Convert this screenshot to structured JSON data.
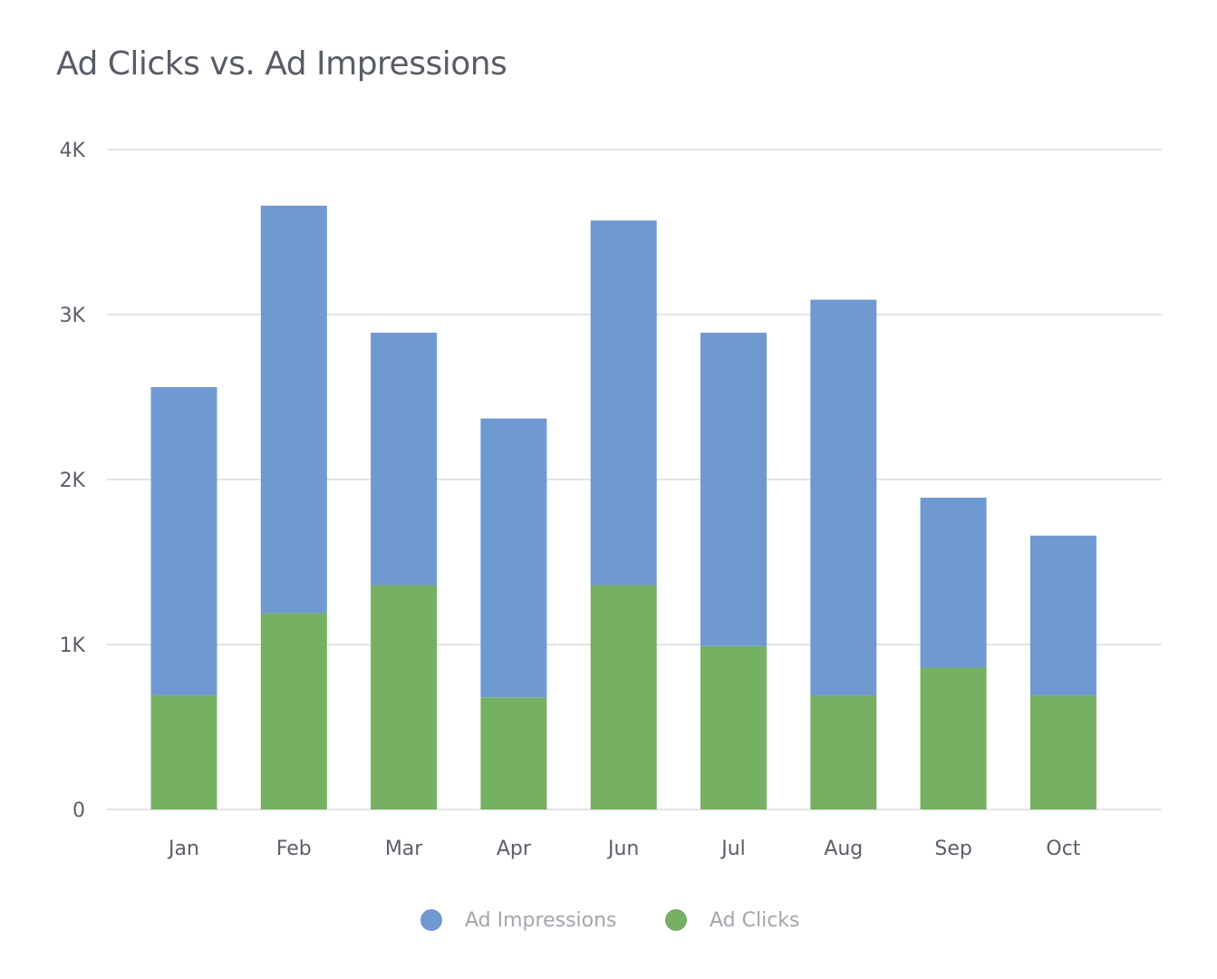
{
  "chart_data": {
    "type": "bar",
    "stacked": true,
    "title": "Ad Clicks vs. Ad Impressions",
    "xlabel": "",
    "ylabel": "",
    "categories": [
      "Jan",
      "Feb",
      "Mar",
      "Apr",
      "Jun",
      "Jul",
      "Aug",
      "Sep",
      "Oct"
    ],
    "series": [
      {
        "name": "Ad Clicks",
        "color": "#75b063",
        "values": [
          690,
          1190,
          1360,
          680,
          1360,
          990,
          690,
          860,
          690
        ]
      },
      {
        "name": "Ad Impressions",
        "color": "#6f99d1",
        "values": [
          1870,
          2470,
          1530,
          1690,
          2210,
          1900,
          2400,
          1030,
          970
        ]
      }
    ],
    "stack_totals": [
      2560,
      3660,
      2890,
      2370,
      3570,
      2890,
      3090,
      1890,
      1660
    ],
    "ylim": [
      0,
      4000
    ],
    "yticks": [
      0,
      1000,
      2000,
      3000,
      4000
    ],
    "ytick_labels": [
      "0",
      "1K",
      "2K",
      "3K",
      "4K"
    ],
    "grid": true,
    "legend": {
      "placement": "bottom-center",
      "entries": [
        {
          "label": "Ad Impressions",
          "color": "#6f99d1"
        },
        {
          "label": "Ad Clicks",
          "color": "#75b063"
        }
      ]
    }
  }
}
